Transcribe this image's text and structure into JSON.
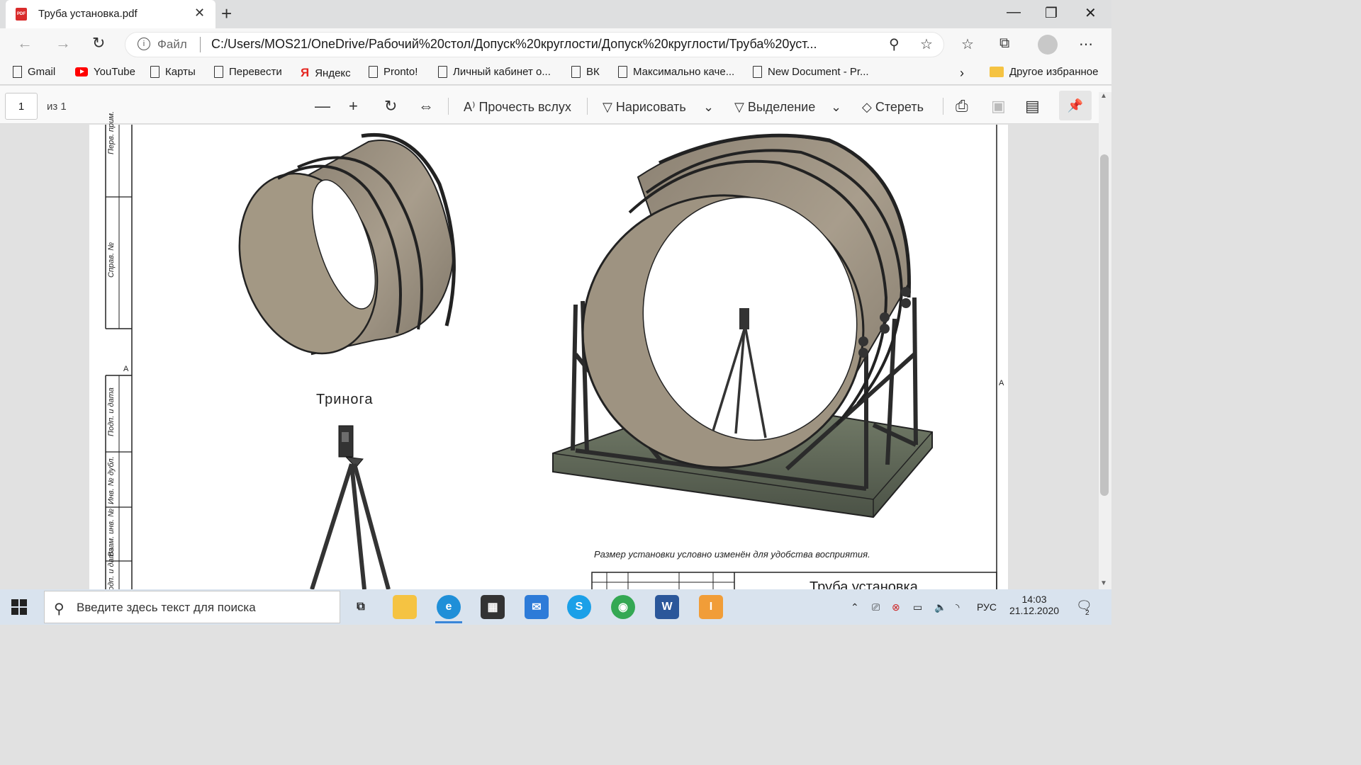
{
  "tab": {
    "title": "Труба установка.pdf",
    "favicon_label": "PDF"
  },
  "address": {
    "scheme_label": "Файл",
    "url": "C:/Users/MOS21/OneDrive/Рабочий%20стол/Допуск%20круглости/Допуск%20круглости/Труба%20уст..."
  },
  "bookmarks": [
    "Gmail",
    "YouTube",
    "Карты",
    "Перевести",
    "Яндекс",
    "Pronto!",
    "Личный кабинет о...",
    "ВК",
    "Максимально каче...",
    "New Document - Pr..."
  ],
  "bookmarks_other": "Другое избранное",
  "pdf_toolbar": {
    "page_number": "1",
    "page_of": "из 1",
    "read_aloud": "Прочесть вслух",
    "draw": "Нарисовать",
    "highlight": "Выделение",
    "erase": "Стереть"
  },
  "drawing": {
    "caption_tripod": "Тринога",
    "note": "Размер установки условно изменён для удобства восприятия.",
    "title_block": "Труба установка",
    "side_labels": [
      "Перв. прим.",
      "Справ. №",
      "Подп. и дата",
      "Инв. № дубл.",
      "Взам. инв. №",
      "Подп. и дата"
    ],
    "zone_mark_left": "А",
    "zone_mark_right": "А"
  },
  "taskbar": {
    "search_placeholder": "Введите здесь текст для поиска",
    "language": "РУС",
    "time": "14:03",
    "date": "21.12.2020",
    "notification_count": "2"
  }
}
